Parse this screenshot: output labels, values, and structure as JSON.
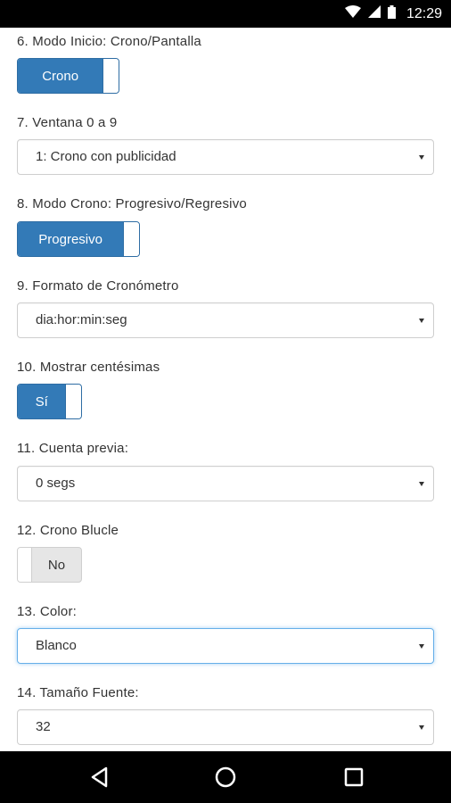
{
  "status_bar": {
    "time": "12:29"
  },
  "settings": [
    {
      "label": "6. Modo Inicio: Crono/Pantalla",
      "control": "toggle",
      "state": "on",
      "value": "Crono"
    },
    {
      "label": "7. Ventana 0 a 9",
      "control": "select",
      "value": "1: Crono con publicidad"
    },
    {
      "label": "8. Modo Crono: Progresivo/Regresivo",
      "control": "toggle",
      "state": "on",
      "value": "Progresivo"
    },
    {
      "label": "9. Formato de Cronómetro",
      "control": "select",
      "value": "dia:hor:min:seg"
    },
    {
      "label": "10. Mostrar centésimas",
      "control": "toggle",
      "state": "on",
      "value": "Sí"
    },
    {
      "label": "11. Cuenta previa:",
      "control": "select",
      "value": "0 segs"
    },
    {
      "label": "12. Crono Blucle",
      "control": "toggle",
      "state": "off",
      "value": "No"
    },
    {
      "label": "13. Color:",
      "control": "select",
      "value": "Blanco",
      "focused": true
    },
    {
      "label": "14. Tamaño Fuente:",
      "control": "select",
      "value": "32"
    }
  ],
  "nav_bar": {
    "buttons": [
      "back",
      "home",
      "recents"
    ]
  }
}
